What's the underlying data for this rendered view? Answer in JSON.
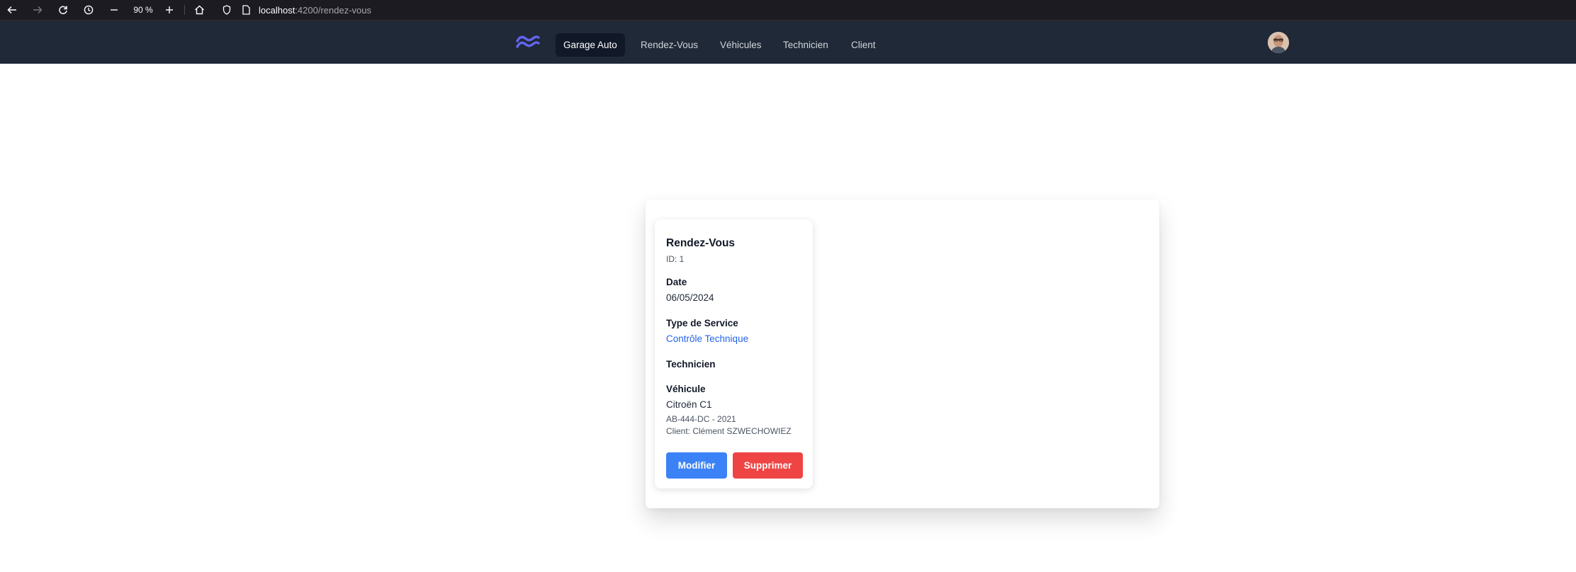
{
  "browser": {
    "zoom": "90 %",
    "url_host": "localhost",
    "url_path": ":4200/rendez-vous"
  },
  "navbar": {
    "items": [
      {
        "label": "Garage Auto",
        "active": true
      },
      {
        "label": "Rendez-Vous",
        "active": false
      },
      {
        "label": "Véhicules",
        "active": false
      },
      {
        "label": "Technicien",
        "active": false
      },
      {
        "label": "Client",
        "active": false
      }
    ],
    "logo_color": "#6366f1"
  },
  "card": {
    "title": "Rendez-Vous",
    "id_text": "ID: 1",
    "date_label": "Date",
    "date_value": "06/05/2024",
    "service_label": "Type de Service",
    "service_value": "Contrôle Technique",
    "technicien_label": "Technicien",
    "vehicule_label": "Véhicule",
    "vehicule_model": "Citroën C1",
    "vehicule_plate_year": "AB-444-DC - 2021",
    "vehicule_client": "Client: Clément SZWECHOWIEZ",
    "modify_label": "Modifier",
    "delete_label": "Supprimer"
  },
  "colors": {
    "navbar_bg": "#1f2937",
    "primary": "#3b82f6",
    "danger": "#ef4444",
    "link": "#2563eb"
  }
}
